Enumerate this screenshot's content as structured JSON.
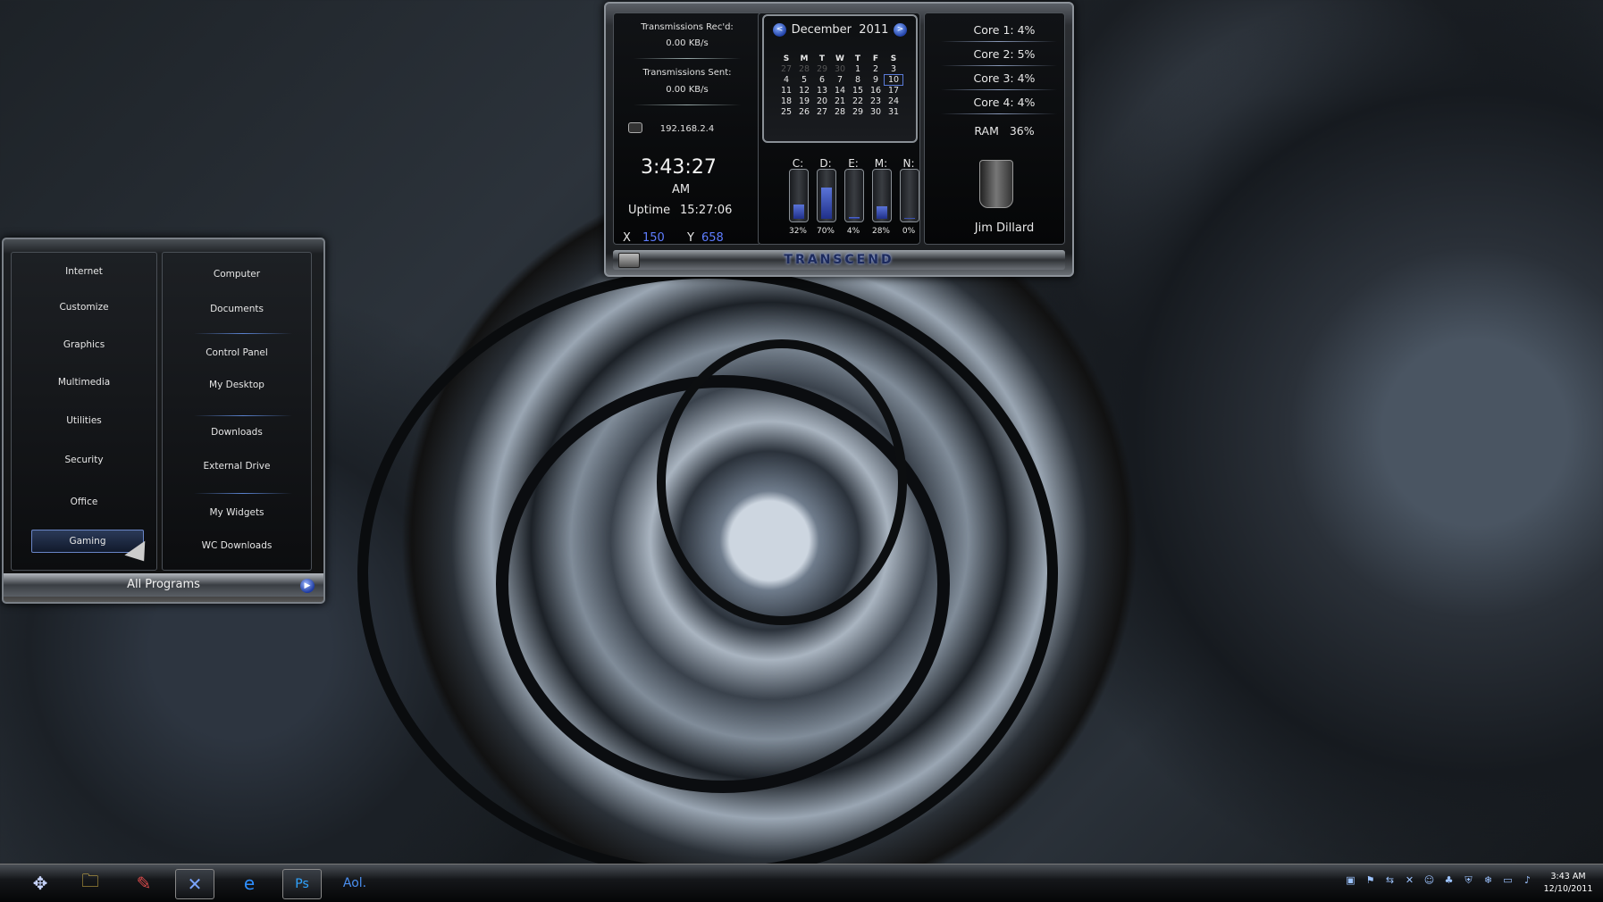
{
  "gadget": {
    "net_recv_label": "Transmissions Rec'd:",
    "net_recv_value": "0.00 KB/s",
    "net_sent_label": "Transmissions Sent:",
    "net_sent_value": "0.00 KB/s",
    "ip": "192.168.2.4",
    "time": "3:43:27",
    "ampm": "AM",
    "uptime_label": "Uptime",
    "uptime_value": "15:27:06",
    "x_label": "X",
    "x_value": "150",
    "y_label": "Y",
    "y_value": "658",
    "calendar": {
      "month": "December",
      "year": "2011",
      "prev": "<",
      "next": ">",
      "days_of_week": [
        "S",
        "M",
        "T",
        "W",
        "T",
        "F",
        "S"
      ],
      "weeks": [
        [
          "27",
          "28",
          "29",
          "30",
          "1",
          "2",
          "3"
        ],
        [
          "4",
          "5",
          "6",
          "7",
          "8",
          "9",
          "10"
        ],
        [
          "11",
          "12",
          "13",
          "14",
          "15",
          "16",
          "17"
        ],
        [
          "18",
          "19",
          "20",
          "21",
          "22",
          "23",
          "24"
        ],
        [
          "25",
          "26",
          "27",
          "28",
          "29",
          "30",
          "31"
        ]
      ],
      "today": "10"
    },
    "drives": [
      {
        "label": "C:",
        "pct": "32%",
        "level": 0.32
      },
      {
        "label": "D:",
        "pct": "70%",
        "level": 0.7
      },
      {
        "label": "E:",
        "pct": "4%",
        "level": 0.04
      },
      {
        "label": "M:",
        "pct": "28%",
        "level": 0.28
      },
      {
        "label": "N:",
        "pct": "0%",
        "level": 0.0
      }
    ],
    "cores": [
      {
        "label": "Core 1:",
        "value": "4%"
      },
      {
        "label": "Core 2:",
        "value": "5%"
      },
      {
        "label": "Core 3:",
        "value": "4%"
      },
      {
        "label": "Core 4:",
        "value": "4%"
      }
    ],
    "ram_label": "RAM",
    "ram_value": "36%",
    "user_name": "Jim Dillard",
    "brand": "TRANSCEND"
  },
  "start_menu": {
    "left_items": [
      "Internet",
      "Customize",
      "Graphics",
      "Multimedia",
      "Utilities",
      "Security",
      "Office",
      "Gaming"
    ],
    "selected_item": "Gaming",
    "right_items": [
      "Computer",
      "Documents",
      "Control Panel",
      "My Desktop",
      "Downloads",
      "External Drive",
      "My Widgets",
      "WC Downloads"
    ],
    "all_programs": "All Programs"
  },
  "taskbar": {
    "apps": [
      {
        "icon": "start-orb-icon",
        "glyph": "✥"
      },
      {
        "icon": "folder-icon",
        "glyph": "🗀"
      },
      {
        "icon": "paint-icon",
        "glyph": "✎"
      },
      {
        "icon": "tools-icon",
        "glyph": "✕"
      },
      {
        "icon": "internet-explorer-icon",
        "glyph": "e"
      },
      {
        "icon": "photoshop-icon",
        "glyph": "Ps"
      },
      {
        "icon": "aol-icon",
        "glyph": "Aol."
      }
    ],
    "tray_icons": [
      "network-icon",
      "flag-icon",
      "arrows-icon",
      "x-icon",
      "smiley-icon",
      "green-icon",
      "shield-icon",
      "snowflake-icon",
      "display-icon",
      "volume-icon"
    ],
    "clock_time": "3:43 AM",
    "clock_date": "12/10/2011"
  }
}
